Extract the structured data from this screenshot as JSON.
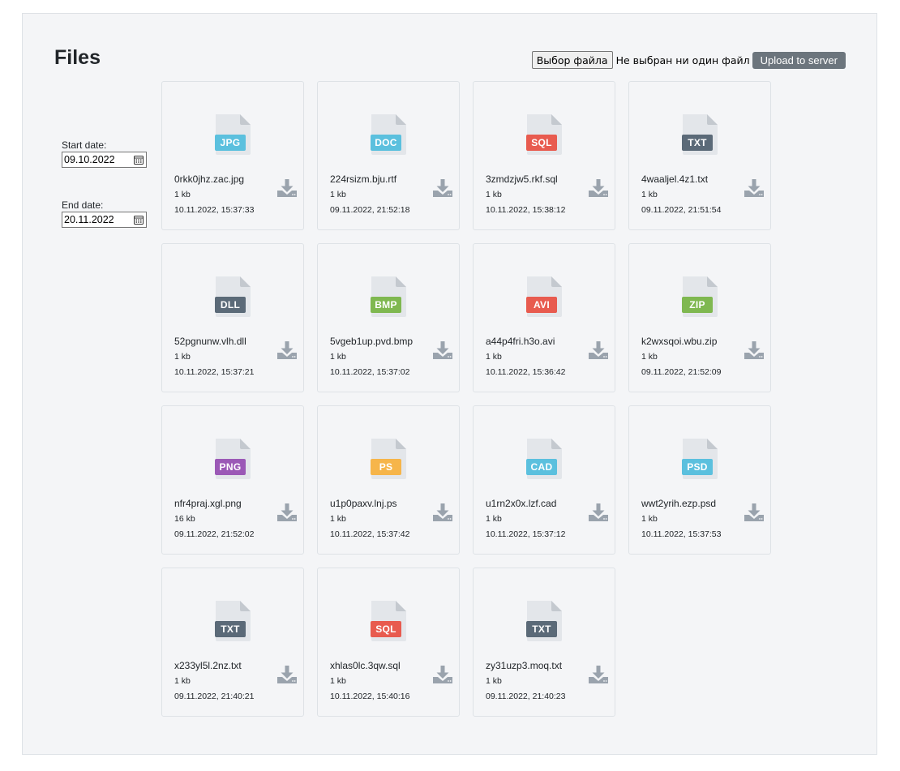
{
  "header": {
    "title": "Files",
    "choose_file_label": "Выбор файла",
    "no_file_chosen": "Не выбран ни один файл",
    "upload_label": "Upload to server"
  },
  "filters": {
    "start_label": "Start date:",
    "start_value": "09.10.2022",
    "end_label": "End date:",
    "end_value": "20.11.2022"
  },
  "colors": {
    "JPG": "#5bc0de",
    "DOC": "#5bc0de",
    "SQL": "#e85b4f",
    "TXT": "#5b6a78",
    "DLL": "#5b6a78",
    "BMP": "#7fb850",
    "AVI": "#e85b4f",
    "ZIP": "#7fb850",
    "PNG": "#9b59b6",
    "PS": "#f6b54a",
    "CAD": "#5bc0de",
    "PSD": "#5bc0de"
  },
  "files": [
    {
      "name": "0rkk0jhz.zac.jpg",
      "ext": "JPG",
      "size": "1 kb",
      "date": "10.11.2022, 15:37:33"
    },
    {
      "name": "224rsizm.bju.rtf",
      "ext": "DOC",
      "size": "1 kb",
      "date": "09.11.2022, 21:52:18"
    },
    {
      "name": "3zmdzjw5.rkf.sql",
      "ext": "SQL",
      "size": "1 kb",
      "date": "10.11.2022, 15:38:12"
    },
    {
      "name": "4waaljel.4z1.txt",
      "ext": "TXT",
      "size": "1 kb",
      "date": "09.11.2022, 21:51:54"
    },
    {
      "name": "52pgnunw.vlh.dll",
      "ext": "DLL",
      "size": "1 kb",
      "date": "10.11.2022, 15:37:21"
    },
    {
      "name": "5vgeb1up.pvd.bmp",
      "ext": "BMP",
      "size": "1 kb",
      "date": "10.11.2022, 15:37:02"
    },
    {
      "name": "a44p4fri.h3o.avi",
      "ext": "AVI",
      "size": "1 kb",
      "date": "10.11.2022, 15:36:42"
    },
    {
      "name": "k2wxsqoi.wbu.zip",
      "ext": "ZIP",
      "size": "1 kb",
      "date": "09.11.2022, 21:52:09"
    },
    {
      "name": "nfr4praj.xgl.png",
      "ext": "PNG",
      "size": "16 kb",
      "date": "09.11.2022, 21:52:02"
    },
    {
      "name": "u1p0paxv.lnj.ps",
      "ext": "PS",
      "size": "1 kb",
      "date": "10.11.2022, 15:37:42"
    },
    {
      "name": "u1rn2x0x.lzf.cad",
      "ext": "CAD",
      "size": "1 kb",
      "date": "10.11.2022, 15:37:12"
    },
    {
      "name": "wwt2yrih.ezp.psd",
      "ext": "PSD",
      "size": "1 kb",
      "date": "10.11.2022, 15:37:53"
    },
    {
      "name": "x233yl5l.2nz.txt",
      "ext": "TXT",
      "size": "1 kb",
      "date": "09.11.2022, 21:40:21"
    },
    {
      "name": "xhlas0lc.3qw.sql",
      "ext": "SQL",
      "size": "1 kb",
      "date": "10.11.2022, 15:40:16"
    },
    {
      "name": "zy31uzp3.moq.txt",
      "ext": "TXT",
      "size": "1 kb",
      "date": "09.11.2022, 21:40:23"
    }
  ]
}
